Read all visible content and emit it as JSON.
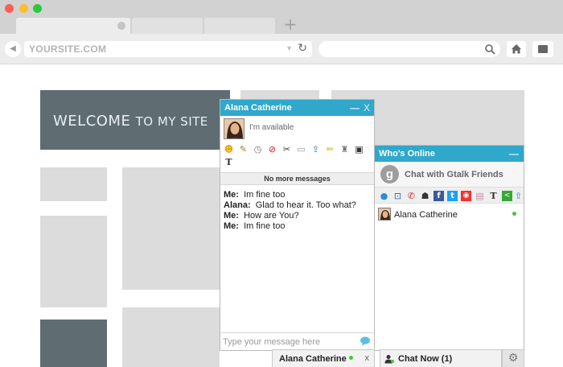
{
  "browser": {
    "dots": [
      "#ff5f57",
      "#febc2e",
      "#28c840"
    ],
    "new_tab_glyph": "+",
    "url": "YOURSITE.COM",
    "reload_glyph": "↻",
    "dropdown_glyph": "▼"
  },
  "page": {
    "welcome_big": "WELCOME",
    "welcome_small": "TO MY SITE",
    "block_light": "#dcdcdc",
    "block_dark": "#5f6d72"
  },
  "chat": {
    "title": "Alana Catherine",
    "minimize": "—",
    "close": "X",
    "status": "I'm available",
    "no_more": "No more messages",
    "messages": [
      {
        "from": "Me:",
        "text": "Im fine too"
      },
      {
        "from": "Alana:",
        "text": "Glad to hear it. Too what?"
      },
      {
        "from": "Me:",
        "text": "How are You?"
      },
      {
        "from": "Me:",
        "text": "Im fine too"
      }
    ],
    "input_placeholder": "Type your message here"
  },
  "who": {
    "title": "Who's Online",
    "minimize": "—",
    "gtalk_letter": "g",
    "gtalk_label": "Chat with Gtalk Friends",
    "contact_name": "Alana Catherine"
  },
  "bottom": {
    "tab_name": "Alana Catherine",
    "tab_close": "x",
    "chat_now": "Chat Now (1)",
    "settings_glyph": "⚙"
  },
  "colors": {
    "accent": "#2fa8cc",
    "online": "#4fc03f"
  }
}
